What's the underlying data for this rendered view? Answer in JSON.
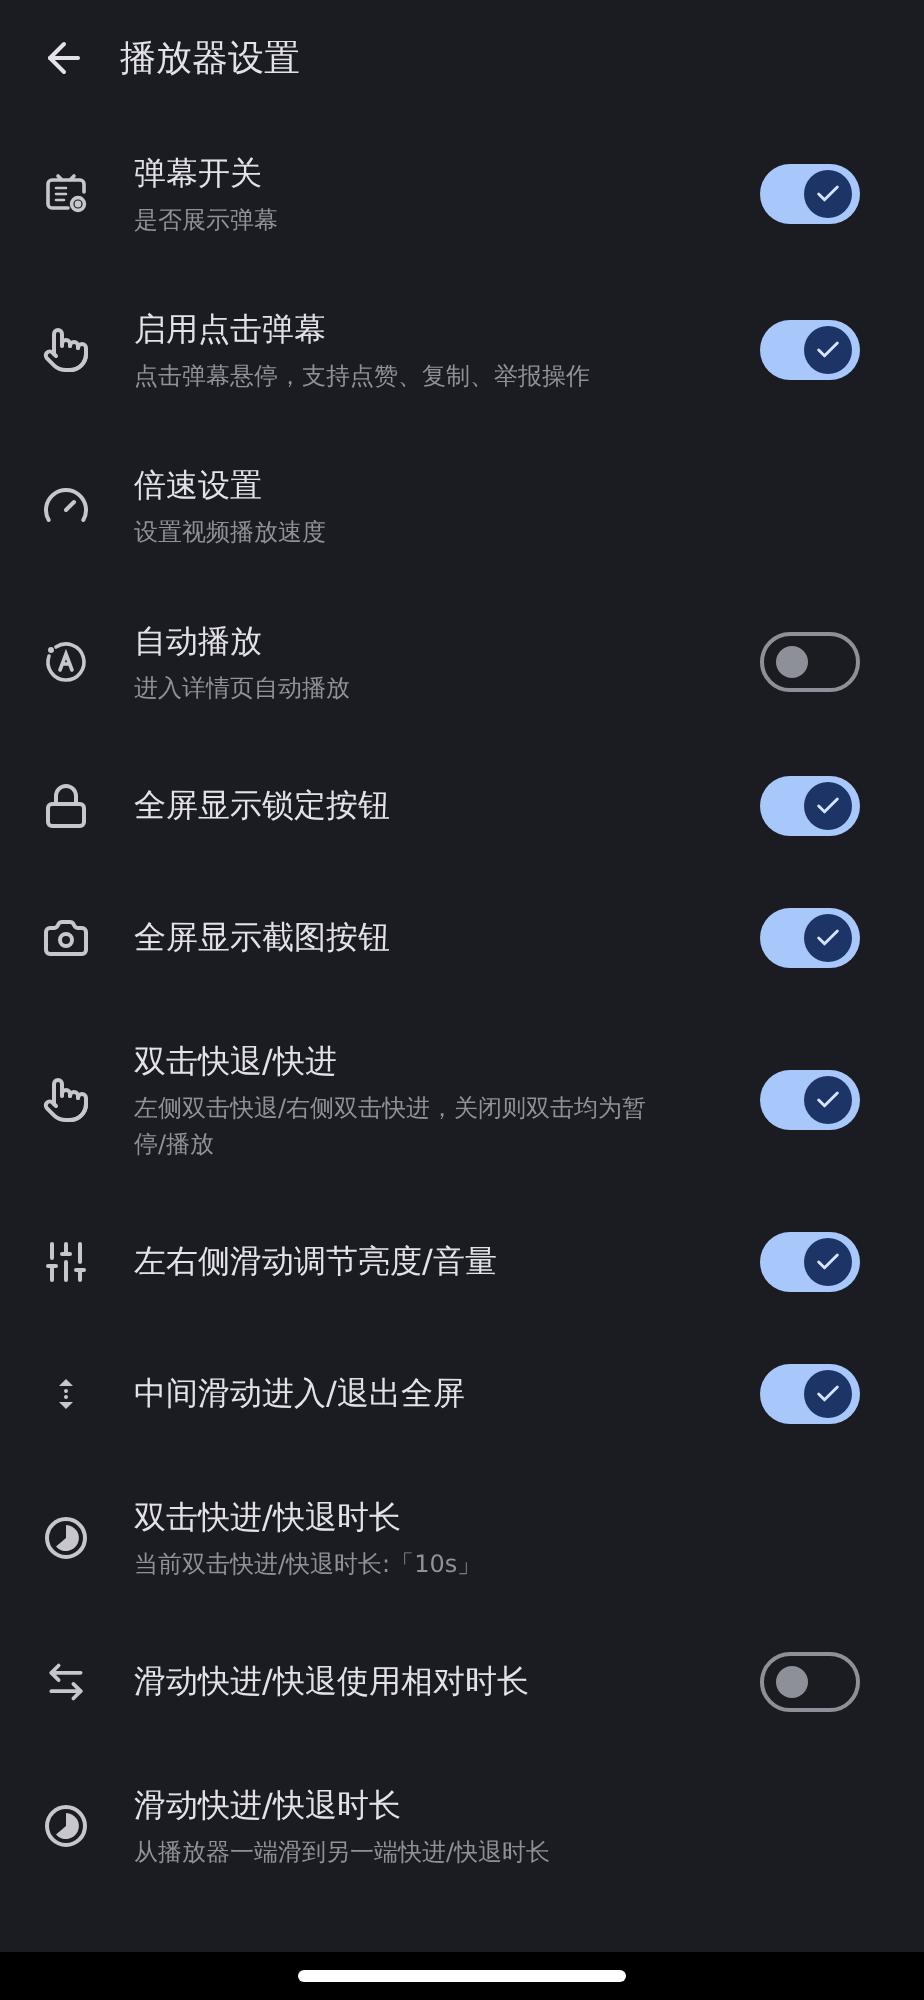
{
  "header": {
    "title": "播放器设置"
  },
  "settings": [
    {
      "kind": "switch",
      "title": "弹幕开关",
      "subtitle": "是否展示弹幕",
      "on": true
    },
    {
      "kind": "switch",
      "title": "启用点击弹幕",
      "subtitle": "点击弹幕悬停，支持点赞、复制、举报操作",
      "on": true
    },
    {
      "kind": "link",
      "title": "倍速设置",
      "subtitle": "设置视频播放速度"
    },
    {
      "kind": "switch",
      "title": "自动播放",
      "subtitle": "进入详情页自动播放",
      "on": false
    },
    {
      "kind": "switch",
      "title": "全屏显示锁定按钮",
      "on": true
    },
    {
      "kind": "switch",
      "title": "全屏显示截图按钮",
      "on": true
    },
    {
      "kind": "switch",
      "title": "双击快退/快进",
      "subtitle": "左侧双击快退/右侧双击快进，关闭则双击均为暂停/播放",
      "on": true
    },
    {
      "kind": "switch",
      "title": "左右侧滑动调节亮度/音量",
      "on": true
    },
    {
      "kind": "switch",
      "title": "中间滑动进入/退出全屏",
      "on": true
    },
    {
      "kind": "link",
      "title": "双击快进/快退时长",
      "subtitle": "当前双击快进/快退时长:「10s」"
    },
    {
      "kind": "switch",
      "title": "滑动快进/快退使用相对时长",
      "on": false
    },
    {
      "kind": "link",
      "title": "滑动快进/快退时长",
      "subtitle": "从播放器一端滑到另一端快进/快退时长"
    }
  ]
}
